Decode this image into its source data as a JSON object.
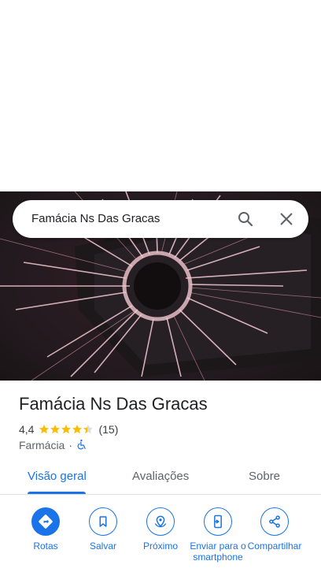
{
  "search": {
    "query": "Famácia Ns Das Gracas"
  },
  "place": {
    "name": "Famácia Ns Das Gracas",
    "rating": "4,4",
    "rating_value": 4.4,
    "review_count": "(15)",
    "category": "Farmácia",
    "separator": "·"
  },
  "tabs": [
    {
      "label": "Visão geral",
      "active": true
    },
    {
      "label": "Avaliações",
      "active": false
    },
    {
      "label": "Sobre",
      "active": false
    }
  ],
  "actions": [
    {
      "label": "Rotas",
      "icon": "directions-icon"
    },
    {
      "label": "Salvar",
      "icon": "bookmark-icon"
    },
    {
      "label": "Próximo",
      "icon": "nearby-icon"
    },
    {
      "label": "Enviar para o smartphone",
      "icon": "send-to-phone-icon"
    },
    {
      "label": "Compartilhar",
      "icon": "share-icon"
    }
  ],
  "colors": {
    "accent": "#1a73e8",
    "star": "#fbbc04"
  }
}
